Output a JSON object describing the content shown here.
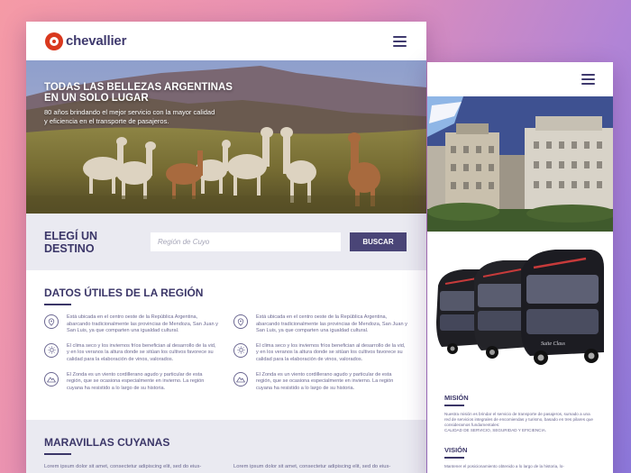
{
  "brand": {
    "name": "chevallier",
    "accent": "#d9381e",
    "primary": "#3b3668"
  },
  "hero": {
    "title": "TODAS LAS BELLEZAS ARGENTINAS\nEN UN SOLO LUGAR",
    "subtitle": "80 años brindando el mejor servicio con la mayor calidad\ny eficiencia en el transporte de pasajeros."
  },
  "search": {
    "label": "ELEGÍ UN DESTINO",
    "placeholder": "Región de Cuyo",
    "button_label": "BUSCAR"
  },
  "datos": {
    "title": "DATOS ÚTILES DE LA REGIÓN",
    "facts": [
      {
        "icon": "map-pin-icon",
        "text": "Está ubicada en el centro oeste de la República Argentina, abarcando tradicionalmente las provincias de Mendoza, San Juan y San Luis, ya que comparten una igualdad cultural."
      },
      {
        "icon": "map-pin-icon",
        "text": "Está ubicada en el centro oeste de la República Argentina, abarcando tradicionalmente las provincias de Mendoza, San Juan y San Luis, ya que comparten una igualdad cultural."
      },
      {
        "icon": "sun-icon",
        "text": "El clima seco y los inviernos fríos benefician al desarrollo de la vid, y en los veranos la altura donde se sitúan los cultivos favorece su calidad para la elaboración de vinos, valorados."
      },
      {
        "icon": "sun-icon",
        "text": "El clima seco y los inviernos fríos benefician al desarrollo de la vid, y en los veranos la altura donde se sitúan los cultivos favorece su calidad para la elaboración de vinos, valorados."
      },
      {
        "icon": "mountain-icon",
        "text": "El Zonda es un viento cordillerano agudo y particular de esta región, que se ocasiona especialmente en invierno. La región cuyana ha resistido a lo largo de su historia."
      },
      {
        "icon": "mountain-icon",
        "text": "El Zonda es un viento cordillerano agudo y particular de esta región, que se ocasiona especialmente en invierno. La región cuyana ha resistido a lo largo de su historia."
      }
    ]
  },
  "maravillas": {
    "title": "MARAVILLAS CUYANAS",
    "col1": "Lorem ipsum dolor sit amet, consectetur adipiscing elit, sed do eius-",
    "col2": "Lorem ipsum dolor sit amet, consectetur adipiscing elit, sed do eius-"
  },
  "back": {
    "mision_title": "MISIÓN",
    "mision_text": "Nuestra misión es brindar el servicio de transporte de pasajeros, sumado a una red de servicios integrales de encomiendas y turismo, basado en tres pilares que consideramos fundamentales:",
    "mision_caps": "CALIDAD DE SERVICIO, SEGURIDAD Y EFICIENCIA.",
    "vision_title": "VISIÓN",
    "vision_text": "Mantener el posicionamiento obtenido a lo largo de la historia, lo-",
    "bus_label": "Suite Class"
  }
}
